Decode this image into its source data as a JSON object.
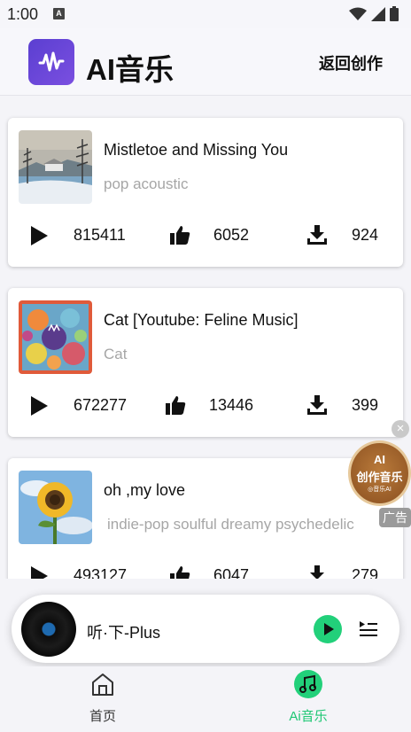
{
  "status_bar": {
    "time": "1:00",
    "badge": "A"
  },
  "header": {
    "title": "AI音乐",
    "back_label": "返回创作"
  },
  "songs": [
    {
      "title": "Mistletoe and Missing You",
      "tags": "pop acoustic",
      "plays": "815411",
      "likes": "6052",
      "downloads": "924",
      "cover": "winter-lake"
    },
    {
      "title": "Cat [Youtube: Feline Music]",
      "tags": "Cat",
      "plays": "672277",
      "likes": "13446",
      "downloads": "399",
      "cover": "colorful-cats"
    },
    {
      "title": "oh ,my love",
      "tags": "indie-pop soulful  dreamy psychedelic",
      "plays": "493127",
      "likes": "6047",
      "downloads": "279",
      "cover": "sunflower"
    }
  ],
  "float_ad": {
    "line1": "AI",
    "line2": "创作音乐",
    "line3": "◎音乐AI",
    "close": "×",
    "label": "广告"
  },
  "player": {
    "title": "听·下-Plus"
  },
  "tabs": [
    {
      "label": "首页",
      "icon": "home-icon",
      "active": false
    },
    {
      "label": "Ai音乐",
      "icon": "music-note-icon",
      "active": true
    }
  ],
  "colors": {
    "accent_green": "#22d07a",
    "logo_purple": "#6a48d9",
    "tag_gray": "#a6a6a6"
  }
}
